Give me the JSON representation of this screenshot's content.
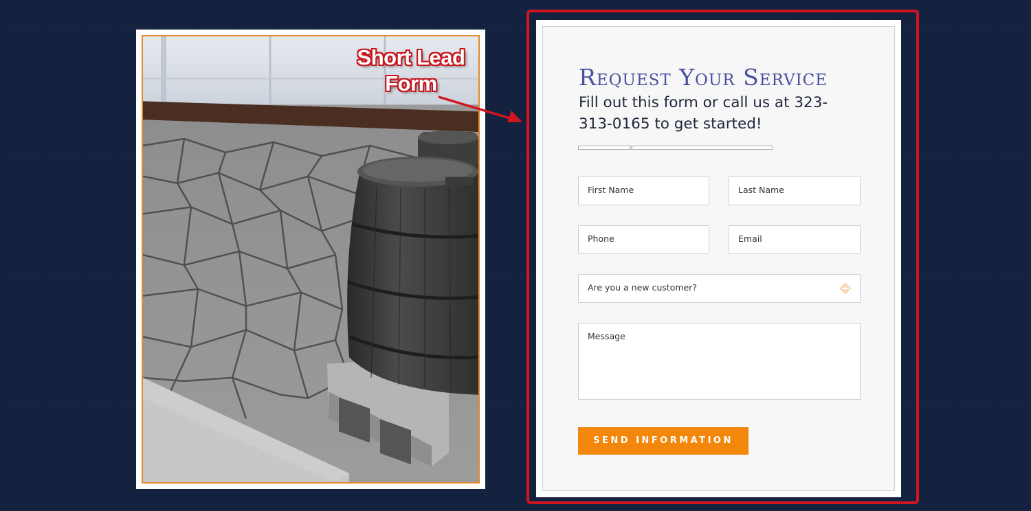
{
  "callout": {
    "line1": "Short Lead",
    "line2": "Form"
  },
  "form": {
    "title": "Request Your Service",
    "subtitle": "Fill out this form or call us at 323-313-0165 to get started!",
    "fields": {
      "first_name": "First Name",
      "last_name": "Last Name",
      "phone": "Phone",
      "email": "Email",
      "new_customer": "Are you a new customer?",
      "message": "Message"
    },
    "submit_label": "SEND INFORMATION"
  },
  "colors": {
    "page_background": "#14223f",
    "title": "#4a4f9e",
    "button": "#f2870b",
    "highlight_border": "#d3151f",
    "photo_border": "#e08a2c"
  },
  "icons": {
    "select": "diamond-chevron-icon",
    "callout_arrow": "red-arrow-icon"
  }
}
